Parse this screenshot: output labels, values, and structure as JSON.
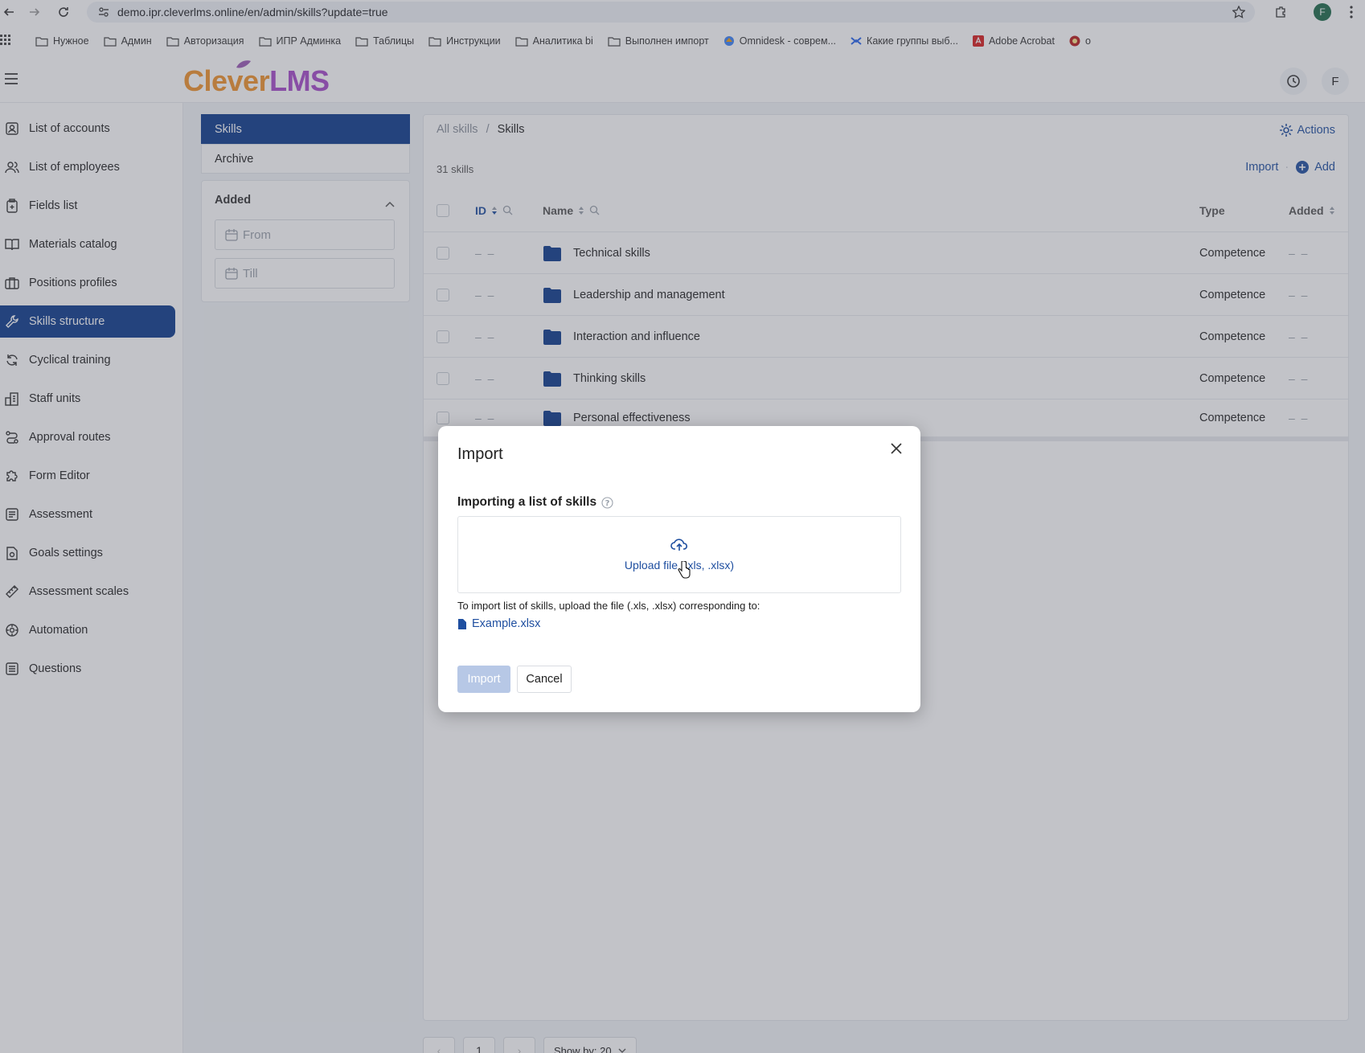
{
  "browser": {
    "url": "demo.ipr.cleverlms.online/en/admin/skills?update=true",
    "bookmarks": [
      "Нужное",
      "Админ",
      "Авторизация",
      "ИПР Админка",
      "Таблицы",
      "Инструкции",
      "Аналитика bi",
      "Выполнен импорт",
      "Omnidesk - соврем...",
      "Какие группы выб...",
      "Adobe Acrobat",
      "o"
    ],
    "profile_initial": "F"
  },
  "header": {
    "logo_clever": "Clever",
    "logo_lms": "LMS",
    "avatar": "F"
  },
  "sidebar": {
    "items": [
      {
        "label": "List of accounts"
      },
      {
        "label": "List of employees"
      },
      {
        "label": "Fields list"
      },
      {
        "label": "Materials catalog"
      },
      {
        "label": "Positions profiles"
      },
      {
        "label": "Skills structure"
      },
      {
        "label": "Cyclical training"
      },
      {
        "label": "Staff units"
      },
      {
        "label": "Approval routes"
      },
      {
        "label": "Form Editor"
      },
      {
        "label": "Assessment"
      },
      {
        "label": "Goals settings"
      },
      {
        "label": "Assessment scales"
      },
      {
        "label": "Automation"
      },
      {
        "label": "Questions"
      }
    ],
    "active": "Skills structure"
  },
  "filters": {
    "tabs": [
      "Skills",
      "Archive"
    ],
    "added_title": "Added",
    "from_placeholder": "From",
    "till_placeholder": "Till"
  },
  "content": {
    "breadcrumb_root": "All skills",
    "breadcrumb_sep": "/",
    "breadcrumb_current": "Skills",
    "actions_label": "Actions",
    "count": "31 skills",
    "import_label": "Import",
    "add_label": "Add",
    "columns": {
      "id": "ID",
      "name": "Name",
      "type": "Type",
      "added": "Added"
    },
    "rows": [
      {
        "id": "– –",
        "name": "Technical skills",
        "type": "Competence",
        "added": "– –"
      },
      {
        "id": "– –",
        "name": "Leadership and management",
        "type": "Competence",
        "added": "– –"
      },
      {
        "id": "– –",
        "name": "Interaction and influence",
        "type": "Competence",
        "added": "– –"
      },
      {
        "id": "– –",
        "name": "Thinking skills",
        "type": "Competence",
        "added": "– –"
      },
      {
        "id": "– –",
        "name": "Personal effectiveness",
        "type": "Competence",
        "added": "– –"
      }
    ],
    "pagination": {
      "page": "1",
      "show_by": "Show by: 20"
    }
  },
  "modal": {
    "title": "Import",
    "section_label": "Importing a list of skills",
    "upload_label": "Upload file (.xls, .xlsx)",
    "hint": "To import list of skills, upload the file (.xls, .xlsx) corresponding to:",
    "example_file": "Example.xlsx",
    "import_button": "Import",
    "cancel_button": "Cancel"
  },
  "colors": {
    "primary": "#0d3b8c",
    "link": "#1f4fa0",
    "accent_orange": "#f0932b",
    "accent_purple": "#a64bc9"
  }
}
